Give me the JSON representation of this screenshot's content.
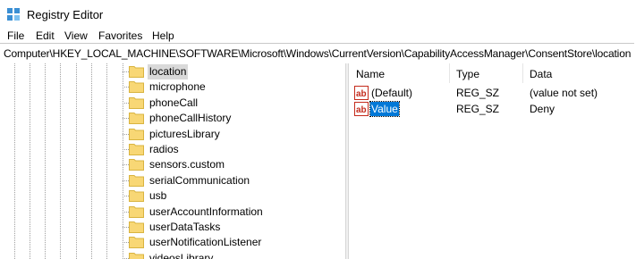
{
  "window": {
    "title": "Registry Editor"
  },
  "menu": [
    "File",
    "Edit",
    "View",
    "Favorites",
    "Help"
  ],
  "address": {
    "path": "Computer\\HKEY_LOCAL_MACHINE\\SOFTWARE\\Microsoft\\Windows\\CurrentVersion\\CapabilityAccessManager\\ConsentStore\\location"
  },
  "tree": {
    "selected": "location",
    "items": [
      "location",
      "microphone",
      "phoneCall",
      "phoneCallHistory",
      "picturesLibrary",
      "radios",
      "sensors.custom",
      "serialCommunication",
      "usb",
      "userAccountInformation",
      "userDataTasks",
      "userNotificationListener",
      "videosLibrary"
    ]
  },
  "values_pane": {
    "columns": {
      "name": "Name",
      "type": "Type",
      "data": "Data"
    },
    "rows": [
      {
        "name": "(Default)",
        "type": "REG_SZ",
        "data": "(value not set)",
        "icon": "string-value-icon"
      },
      {
        "name": "Value",
        "type": "REG_SZ",
        "data": "Deny",
        "icon": "string-value-icon",
        "selected": true
      }
    ]
  },
  "colors": {
    "selection": "#0078d7",
    "folder": "#f8d775",
    "tree_selection": "#d9d9d9"
  }
}
